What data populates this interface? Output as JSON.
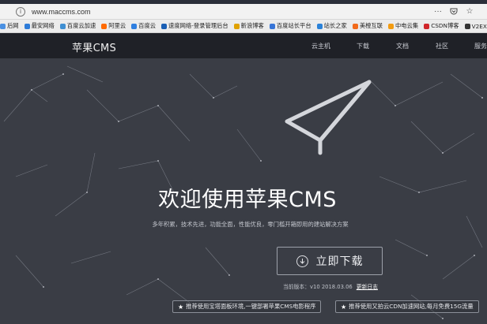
{
  "browser": {
    "url": "www.maccms.com",
    "actions": [
      "···",
      "☆"
    ]
  },
  "bookmarks": [
    {
      "label": "后网",
      "color": "#4a90e2"
    },
    {
      "label": "最安网络",
      "color": "#2d7bd8"
    },
    {
      "label": "百度云加速",
      "color": "#3f8fd2"
    },
    {
      "label": "阿里云",
      "color": "#ff6a00"
    },
    {
      "label": "百度云",
      "color": "#2f7fe0"
    },
    {
      "label": "速度网络-登录管理后台",
      "color": "#1a5fb4"
    },
    {
      "label": "新浪博客",
      "color": "#e0a100"
    },
    {
      "label": "百度站长平台",
      "color": "#3875d7"
    },
    {
      "label": "站长之家",
      "color": "#2b82d9"
    },
    {
      "label": "美橙互联",
      "color": "#f26a1b"
    },
    {
      "label": "中电云集",
      "color": "#f39c12"
    },
    {
      "label": "CSDN博客",
      "color": "#d0262a"
    },
    {
      "label": "V2EX",
      "color": "#333333"
    }
  ],
  "nav": {
    "brand": "苹果CMS",
    "links": [
      "云主机",
      "下载",
      "文档",
      "社区",
      "服务"
    ]
  },
  "hero": {
    "title": "欢迎使用苹果CMS",
    "subtitle": "多年积累，技术先进，功能全面，性能优良，零门槛开箱即用的建站解决方案",
    "download_label": "立即下载",
    "version_text": "当前版本：v10 2018.03.06",
    "changelog_label": "更新日志",
    "promo_left": "推荐使用宝塔面板环境,一键部署苹果CMS电影程序",
    "promo_right": "推荐使用又拍云CDN加速网站,每月免费15G流量"
  }
}
